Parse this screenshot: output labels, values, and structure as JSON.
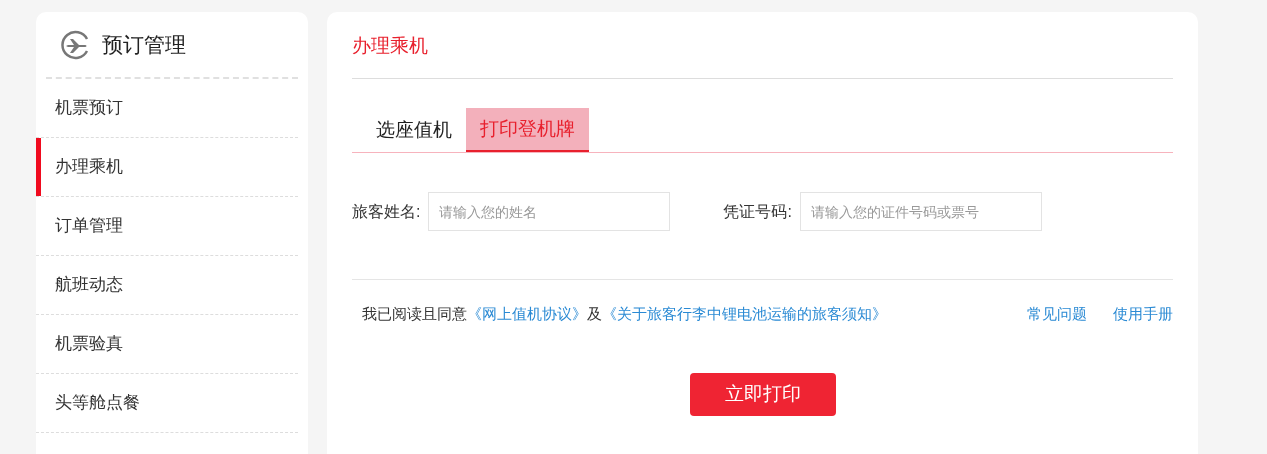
{
  "sidebar": {
    "title": "预订管理",
    "items": [
      {
        "label": "机票预订",
        "selected": false
      },
      {
        "label": "办理乘机",
        "selected": true
      },
      {
        "label": "订单管理",
        "selected": false
      },
      {
        "label": "航班动态",
        "selected": false
      },
      {
        "label": "机票验真",
        "selected": false
      },
      {
        "label": "头等舱点餐",
        "selected": false
      }
    ]
  },
  "main": {
    "title": "办理乘机",
    "tabs": [
      {
        "label": "选座值机",
        "selected": false
      },
      {
        "label": "打印登机牌",
        "selected": true
      }
    ],
    "fields": [
      {
        "label": "旅客姓名:",
        "placeholder": "请输入您的姓名"
      },
      {
        "label": "凭证号码:",
        "placeholder": "请输入您的证件号码或票号"
      }
    ],
    "agreement": {
      "prefix": "我已阅读且同意",
      "link_1": "《网上值机协议》",
      "middle": "及",
      "link_2": "《关于旅客行李中锂电池运输的旅客须知》"
    },
    "help_links": [
      "常见问题",
      "使用手册"
    ],
    "submit": "立即打印"
  }
}
